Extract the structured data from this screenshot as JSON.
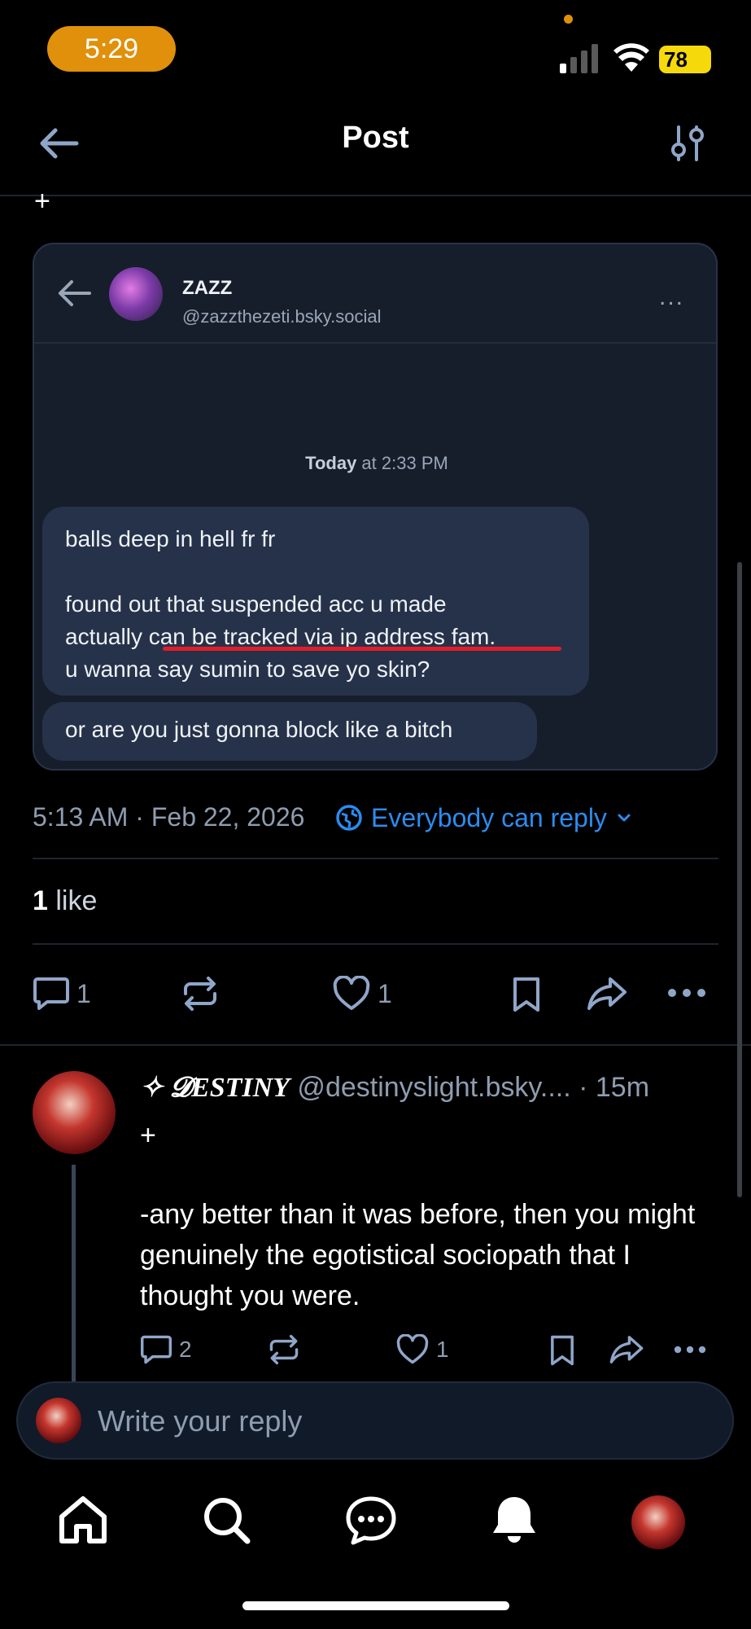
{
  "status_bar": {
    "time": "5:29",
    "battery": "78"
  },
  "header": {
    "title": "Post",
    "back_icon": "arrow-left-icon",
    "filter_icon": "sliders-icon"
  },
  "post": {
    "top_plus": "+",
    "embedded_image": {
      "name": "ZAZZ",
      "handle": "@zazzthezeti.bsky.social",
      "timestamp_bold": "Today",
      "timestamp_rest": " at 2:33 PM",
      "bubble_one": "balls deep in hell fr fr\n\nfound out that suspended acc u made\nactually can be tracked via ip address fam.\nu wanna say sumin to save yo skin?",
      "bubble_two": "or are you just gonna block like a bitch",
      "more": "..."
    },
    "date": "5:13 AM · Feb 22, 2026",
    "reply_settings": "Everybody can reply",
    "likes_count": "1",
    "likes_word": "like",
    "actions": {
      "reply_count": "1",
      "like_count": "1"
    }
  },
  "reply": {
    "name": "✧ 𝓓ESTINY",
    "handle_time": " @destinyslight.bsky.... · 15m",
    "plus": "+",
    "text": "-any better than it was before, then you might genuinely the egotistical sociopath that I thought you were.",
    "reply_count": "2",
    "like_count": "1"
  },
  "composer": {
    "placeholder": "Write your reply"
  },
  "colors": {
    "accent": "#2b8cf0",
    "muted": "#8f9db0",
    "status_pill": "#e0900a",
    "battery": "#f5d90a"
  }
}
